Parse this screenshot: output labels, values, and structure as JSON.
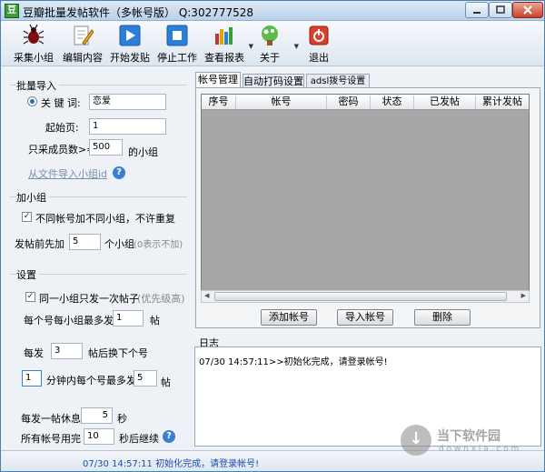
{
  "window": {
    "title": "豆瓣批量发帖软件（多帐号版）  Q:302777528",
    "app_icon_text": "豆"
  },
  "toolbar": {
    "items": [
      {
        "label": "采集小组",
        "icon": "bug-icon"
      },
      {
        "label": "编辑内容",
        "icon": "edit-icon"
      },
      {
        "label": "开始发贴",
        "icon": "play-icon"
      },
      {
        "label": "停止工作",
        "icon": "stop-icon"
      },
      {
        "label": "查看报表",
        "icon": "report-icon"
      },
      {
        "label": "关于",
        "icon": "about-icon"
      },
      {
        "label": "退出",
        "icon": "exit-icon"
      }
    ]
  },
  "left": {
    "batch_import": {
      "title": "批量导入",
      "keyword_label": "关 键 词:",
      "keyword_value": "恋爱",
      "start_page_label": "起始页:",
      "start_page_value": "1",
      "min_members_label": "只采成员数>=",
      "min_members_value": "500",
      "min_members_suffix": "的小组",
      "import_file_link": "从文件导入小组id"
    },
    "join_group": {
      "title": "加小组",
      "different_groups_label": "不同帐号加不同小组，不许重复",
      "different_groups_checked": true,
      "pre_join_label": "发帖前先加",
      "pre_join_value": "5",
      "pre_join_suffix": "个小组",
      "pre_join_note": "(0表示不加)"
    },
    "settings": {
      "title": "设置",
      "once_per_group_label": "同一小组只发一次帖子",
      "once_per_group_note": "(优先级高)",
      "once_per_group_checked": true,
      "max_per_group_label": "每个号每小组最多发",
      "max_per_group_value": "1",
      "max_per_group_suffix": "帖",
      "switch_after_prefix": "每发",
      "switch_after_value": "3",
      "switch_after_suffix": "帖后换下个号",
      "minutes_value": "1",
      "minutes_label": "分钟内每个号最多发",
      "minutes_max_value": "5",
      "minutes_suffix": "帖",
      "rest_label": "每发一帖休息",
      "rest_value": "5",
      "rest_suffix": "秒",
      "all_used_label": "所有帐号用完",
      "all_used_value": "10",
      "all_used_suffix": "秒后继续"
    }
  },
  "tabs": [
    {
      "label": "帐号管理",
      "active": true
    },
    {
      "label": "自动打码设置",
      "active": false
    },
    {
      "label": "adsl拨号设置",
      "active": false
    }
  ],
  "grid": {
    "columns": [
      "序号",
      "帐号",
      "密码",
      "状态",
      "已发帖",
      "累计发帖"
    ]
  },
  "buttons": {
    "add": "添加帐号",
    "import": "导入帐号",
    "delete": "删除"
  },
  "log": {
    "title": "日志",
    "line": "07/30 14:57:11>>初始化完成，请登录帐号!"
  },
  "status": {
    "text": "07/30 14:57:11 初始化完成，请登录帐号!"
  },
  "watermark": {
    "text": "当下软件园",
    "sub": "d o w n x i a . c o m"
  }
}
